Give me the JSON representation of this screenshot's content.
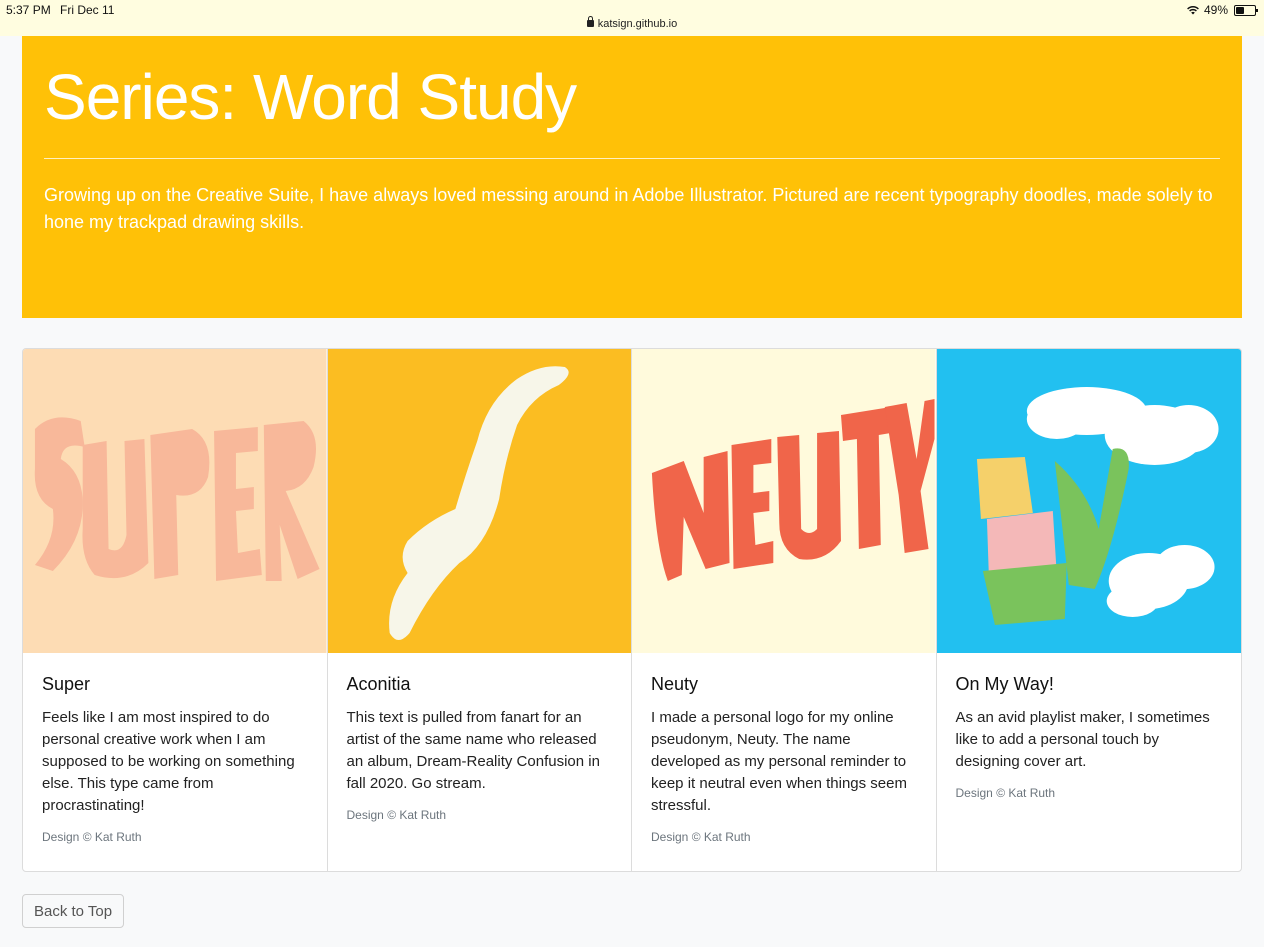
{
  "status_bar": {
    "time": "5:37 PM",
    "date": "Fri Dec 11",
    "url": "katsign.github.io",
    "battery": "49%",
    "battery_level": 0.49
  },
  "header": {
    "title": "Series: Word Study",
    "lead": "Growing up on the Creative Suite, I have always loved messing around in Adobe Illustrator. Pictured are recent typography doodles, made solely to hone my trackpad drawing skills."
  },
  "cards": [
    {
      "title": "Super",
      "text": "Feels like I am most inspired to do personal creative work when I am supposed to be working on something else. This type came from procrastinating!",
      "credit": "Design © Kat Ruth",
      "image_bg": "#fddcb4",
      "image_fg": "#f8b89a"
    },
    {
      "title": "Aconitia",
      "text": "This text is pulled from fanart for an artist of the same name who released an album, Dream-Reality Confusion in fall 2020. Go stream.",
      "credit": "Design © Kat Ruth",
      "image_bg": "#fbbd22",
      "image_fg": "#f7f6e9"
    },
    {
      "title": "Neuty",
      "text": "I made a personal logo for my online pseudonym, Neuty. The name developed as my personal reminder to keep it neutral even when things seem stressful.",
      "credit": "Design © Kat Ruth",
      "image_bg": "#fffadc",
      "image_fg": "#f0654a"
    },
    {
      "title": "On My Way!",
      "text": "As an avid playlist maker, I sometimes like to add a personal touch by designing cover art.",
      "credit": "Design © Kat Ruth",
      "image_bg": "#22c0f0",
      "image_fg": "#ffffff"
    }
  ],
  "footer": {
    "back_to_top": "Back to Top"
  },
  "colors": {
    "jumbotron": "#ffc107",
    "page_bg": "#f8f9fa"
  }
}
